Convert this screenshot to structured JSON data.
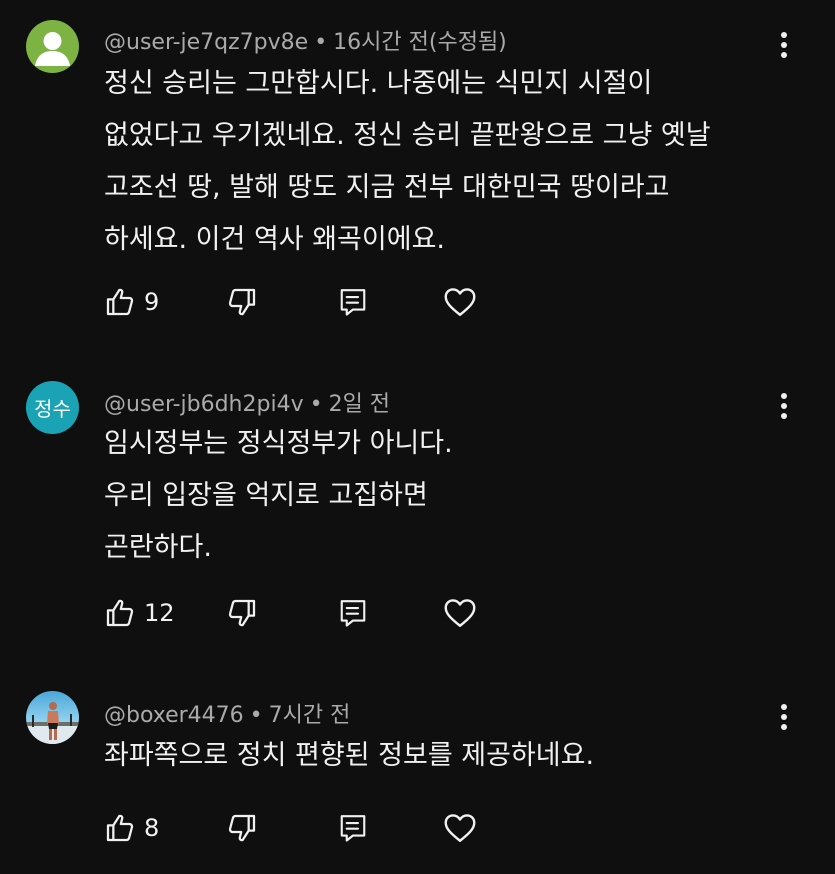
{
  "comments": [
    {
      "author": "@user-je7qz7pv8e",
      "time": "16시간 전(수정됨)",
      "avatar": "default-person-icon",
      "avatar_color": "#7cb342",
      "lines": [
        "정신 승리는 그만합시다. 나중에는 식민지 시절이",
        "없었다고 우기겠네요. 정신 승리 끝판왕으로 그냥 옛날",
        "고조선 땅, 발해 땅도 지금 전부 대한민국 땅이라고",
        "하세요. 이건 역사 왜곡이에요."
      ],
      "likes": "9"
    },
    {
      "author": "@user-jb6dh2pi4v",
      "time": "2일 전",
      "avatar_text": "정수",
      "avatar_color": "#1aa3b5",
      "lines": [
        "임시정부는 정식정부가 아니다.",
        "우리 입장을 억지로 고집하면",
        "곤란하다."
      ],
      "likes": "12"
    },
    {
      "author": "@boxer4476",
      "time": "7시간 전",
      "avatar": "photo-avatar",
      "lines": [
        "좌파쪽으로 정치 편향된 정보를 제공하네요."
      ],
      "likes": "8"
    }
  ],
  "separator": "•",
  "icons": {
    "like": "thumbs-up-icon",
    "dislike": "thumbs-down-icon",
    "reply": "reply-icon",
    "heart": "heart-icon",
    "menu": "more-vert-icon"
  },
  "colors": {
    "background": "#0f0f0f",
    "text": "#f1f1f1",
    "meta": "#aaaaaa"
  }
}
